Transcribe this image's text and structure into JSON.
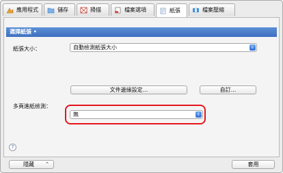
{
  "tabs": [
    {
      "label": "應用程式",
      "icon": "app-icon",
      "active": false
    },
    {
      "label": "儲存",
      "icon": "folder-icon",
      "active": false
    },
    {
      "label": "掃描",
      "icon": "scan-icon",
      "active": false
    },
    {
      "label": "檔案選項",
      "icon": "file-options-icon",
      "active": false
    },
    {
      "label": "紙張",
      "icon": "paper-icon",
      "active": true
    },
    {
      "label": "檔案壓縮",
      "icon": "compression-icon",
      "active": false
    }
  ],
  "section": {
    "title": "選擇紙張"
  },
  "paper_size": {
    "label": "紙張大小：",
    "value": "自動檢測紙張大小"
  },
  "buttons": {
    "file_margin": "文件邊緣設定...",
    "custom": "自訂...",
    "hide": "隱藏",
    "apply": "套用"
  },
  "multifeed": {
    "label": "多頁進紙檢測：",
    "value": "無"
  },
  "help": {
    "symbol": "?"
  },
  "colors": {
    "accent": "#3e6fbf",
    "highlight": "#e4141b"
  }
}
